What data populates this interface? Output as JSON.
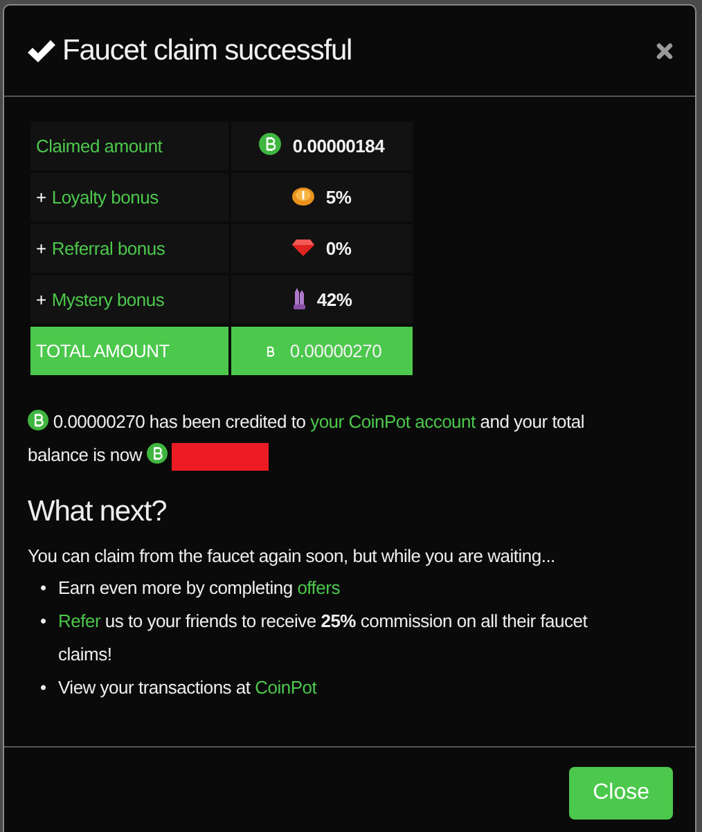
{
  "modal": {
    "title": "Faucet claim successful",
    "table": {
      "rows": [
        {
          "kind": "claimed",
          "prefix": "",
          "label": "Claimed amount",
          "value": "0.00000184"
        },
        {
          "kind": "loyalty",
          "prefix": "+",
          "label": "Loyalty bonus",
          "value": "5%"
        },
        {
          "kind": "referral",
          "prefix": "+",
          "label": "Referral bonus",
          "value": "0%"
        },
        {
          "kind": "mystery",
          "prefix": "+",
          "label": "Mystery bonus",
          "value": "42%"
        },
        {
          "kind": "total",
          "prefix": "",
          "label": "TOTAL AMOUNT",
          "value": "0.00000270"
        }
      ]
    },
    "message": {
      "amount": "0.00000270",
      "segments": [
        {
          "kind": "text",
          "text": "has been credited to"
        },
        {
          "kind": "link",
          "text": "your CoinPot account"
        },
        {
          "kind": "text",
          "text": "and your total balance is now"
        }
      ]
    },
    "heading": "What next?",
    "intro": "You can claim from the faucet again soon, but while you are waiting...",
    "bullets": [
      {
        "marker": "•",
        "segments": [
          {
            "kind": "text",
            "text": "Earn even more by completing"
          },
          {
            "kind": "link",
            "text": "offers"
          }
        ]
      },
      {
        "marker": "•",
        "segments": [
          {
            "kind": "link",
            "text": "Refer"
          },
          {
            "kind": "text",
            "text": "us to your friends to receive **25%** commission on all their faucet claims!"
          }
        ]
      },
      {
        "marker": "•",
        "segments": [
          {
            "kind": "text",
            "text": "View your transactions at"
          },
          {
            "kind": "link",
            "text": "CoinPot"
          }
        ]
      }
    ],
    "buttons": [
      "Close"
    ]
  }
}
